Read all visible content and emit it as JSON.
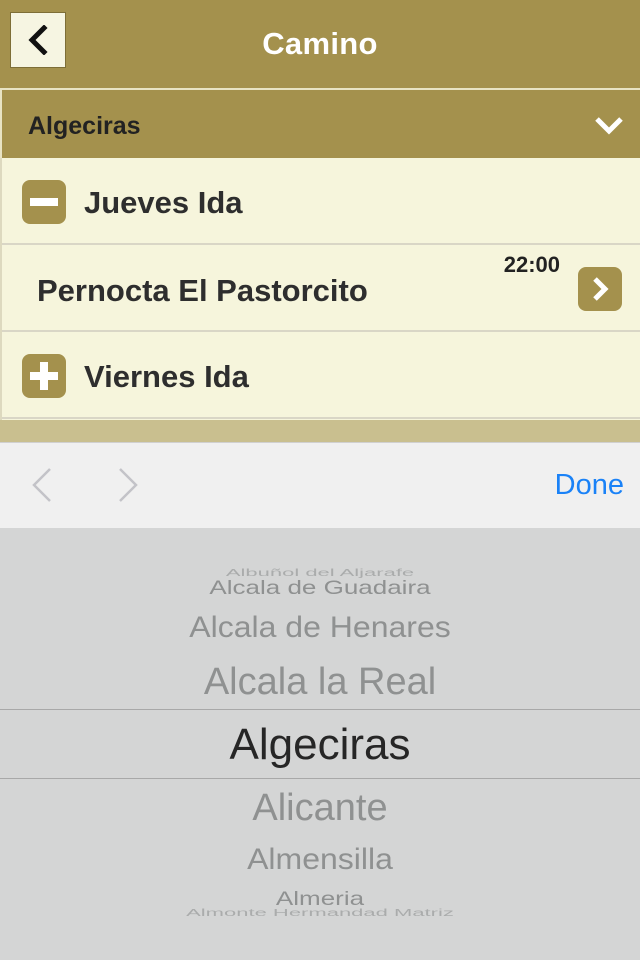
{
  "navbar": {
    "title": "Camino",
    "back_icon": "chevron-left-icon"
  },
  "selector": {
    "value": "Algeciras",
    "icon": "chevron-down-icon"
  },
  "list": {
    "section1_label": "Jueves Ida",
    "item_label": "Pernocta El Pastorcito",
    "item_time": "22:00",
    "section2_label": "Viernes Ida"
  },
  "toolbar": {
    "done_label": "Done"
  },
  "picker": {
    "options": [
      "Albuñol del Aljarafe",
      "Alcala de Guadaira",
      "Alcala de Henares",
      "Alcala la Real",
      "Algeciras",
      "Alicante",
      "Almensilla",
      "Almeria",
      "Almonte Hermandad Matriz"
    ],
    "selected": "Algeciras"
  },
  "colors": {
    "brand": "#a4914d",
    "cream": "#f6f5dc",
    "accent_blue": "#1a82f7"
  }
}
